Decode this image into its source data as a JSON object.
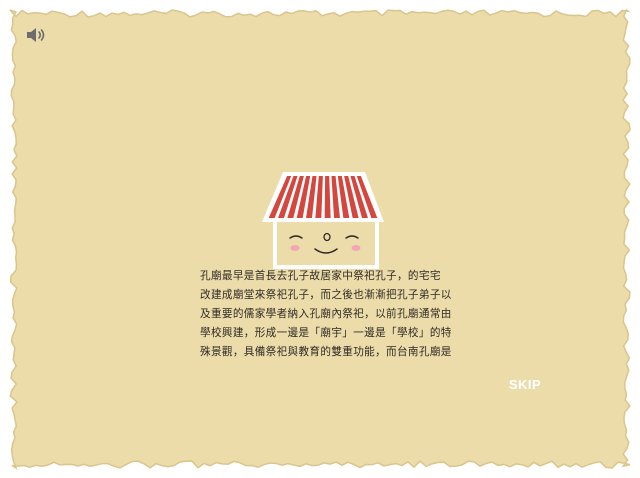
{
  "colors": {
    "paper": "#ebdcaa",
    "paper_edge": "#dac58c",
    "roof_red": "#d4473f",
    "roof_white": "#ffffff",
    "house_face": "#ebdcaa",
    "cheek_pink": "#f3a6b4",
    "text": "#2f2a24",
    "skip_text": "#ffffff"
  },
  "icons": {
    "sound": "speaker-volume-icon",
    "mascot": "temple-house-mascot"
  },
  "intro": {
    "lines": [
      "孔廟最早是首長去孔子故居家中祭祀孔子，的宅宅",
      "改建成廟堂來祭祀孔子，而之後也漸漸把孔子弟子以",
      "及重要的儒家學者納入孔廟內祭祀，以前孔廟通常由",
      "學校興建，形成一邊是「廟宇」一邊是「學校」的特",
      "殊景觀，具備祭祀與教育的雙重功能，而台南孔廟是"
    ]
  },
  "controls": {
    "skip_label": "SKIP"
  }
}
